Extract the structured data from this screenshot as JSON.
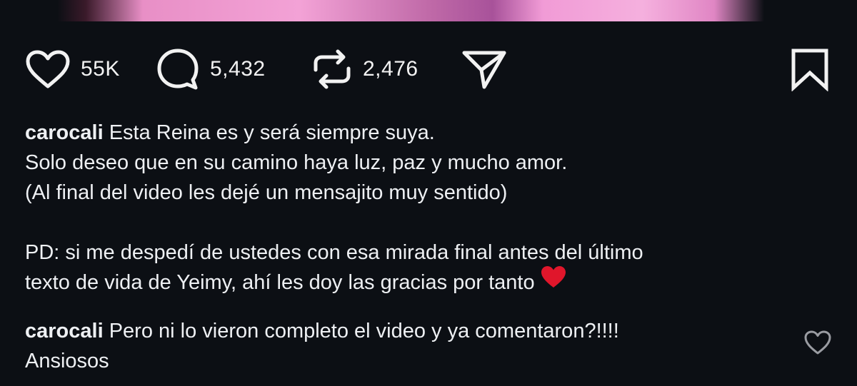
{
  "post": {
    "likes": "55K",
    "comments": "5,432",
    "reposts": "2,476"
  },
  "caption": {
    "username": "carocali",
    "line1": "Esta Reina es y será siempre suya.",
    "line2": "Solo deseo que en su camino haya luz, paz y mucho amor.",
    "line3": "(Al final del video les dejé un mensajito muy sentido)",
    "line4": "PD: si me despedí de ustedes con esa mirada final antes del último",
    "line5": "texto de vida de Yeimy, ahí les doy las gracias por tanto",
    "emoji": "red-heart-icon"
  },
  "comment": {
    "username": "carocali",
    "text": "Pero ni lo vieron completo el video y ya comentaron?!!!!",
    "text2": "Ansiosos"
  },
  "colors": {
    "background": "#0c0f14",
    "text": "#f2f2f2",
    "heart_emoji": "#e0162b"
  }
}
